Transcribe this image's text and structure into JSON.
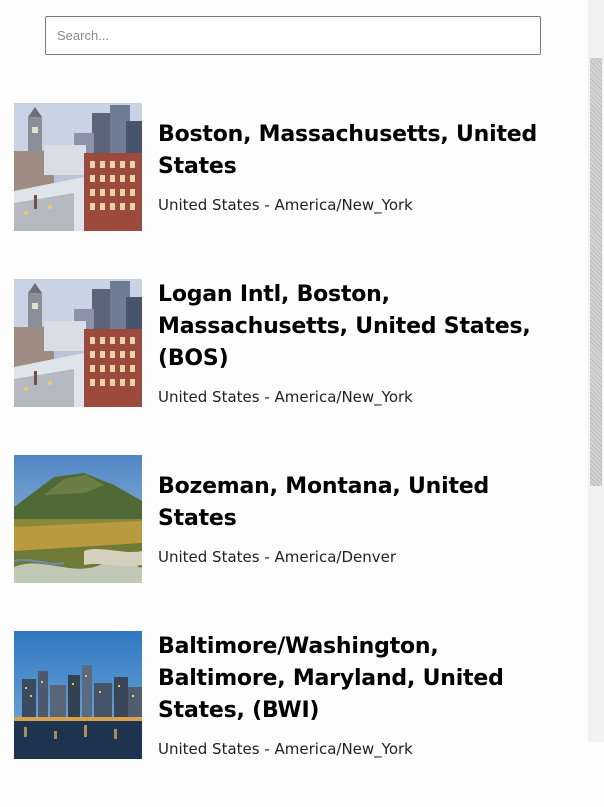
{
  "search": {
    "placeholder": "Search...",
    "value": ""
  },
  "results": [
    {
      "title": "Boston, Massachusetts, United States",
      "subtitle": "United States - America/New_York",
      "image": "boston-skyline-photo"
    },
    {
      "title": "Logan Intl, Boston, Massachusetts, United States, (BOS)",
      "subtitle": "United States - America/New_York",
      "image": "boston-skyline-photo"
    },
    {
      "title": "Bozeman, Montana, United States",
      "subtitle": "United States - America/Denver",
      "image": "montana-meadow-photo"
    },
    {
      "title": "Baltimore/Washington, Baltimore, Maryland, United States, (BWI)",
      "subtitle": "United States - America/New_York",
      "image": "baltimore-harbor-photo"
    }
  ],
  "colors": {
    "background": "#fdfdfd",
    "title": "#000000",
    "subtitle": "#222222",
    "search_border": "#7a7a7a"
  }
}
